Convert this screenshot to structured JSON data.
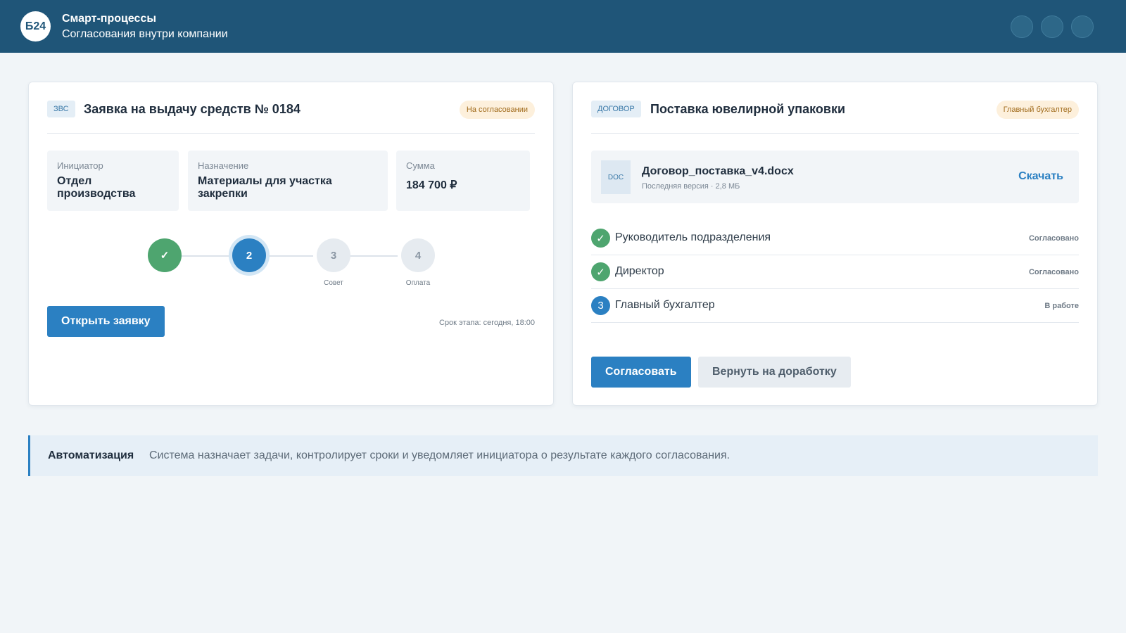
{
  "header": {
    "logo_text": "Б24",
    "title": "Смарт-процессы",
    "subtitle": "Согласования внутри компании"
  },
  "left_card": {
    "tag": "ЗВС",
    "title": "Заявка на выдачу средств № 0184",
    "status_badge": "На согласовании",
    "info": [
      {
        "label": "Инициатор",
        "value": "Отдел производства"
      },
      {
        "label": "Назначение",
        "value": "Материалы для участка закрепки"
      },
      {
        "label": "Сумма",
        "value": "184 700 ₽"
      }
    ],
    "steps": [
      {
        "text": "✓",
        "label": "",
        "state": "done"
      },
      {
        "text": "2",
        "label": "",
        "state": "current"
      },
      {
        "text": "3",
        "label": "Совет",
        "state": "todo"
      },
      {
        "text": "4",
        "label": "Оплата",
        "state": "todo"
      }
    ],
    "open_button": "Открыть заявку",
    "deadline": "Срок этапа: сегодня, 18:00"
  },
  "right_card": {
    "tag": "ДОГОВОР",
    "title": "Поставка ювелирной упаковки",
    "role_badge": "Главный бухгалтер",
    "file": {
      "type": "DOC",
      "name": "Договор_поставка_v4.docx",
      "meta": "Последняя версия · 2,8 МБ",
      "download_label": "Скачать"
    },
    "approvers": [
      {
        "icon": "✓",
        "kind": "ok",
        "name": "Руководитель подразделения",
        "status": "Согласовано"
      },
      {
        "icon": "✓",
        "kind": "ok",
        "name": "Директор",
        "status": "Согласовано"
      },
      {
        "icon": "3",
        "kind": "num",
        "name": "Главный бухгалтер",
        "status": "В работе"
      }
    ],
    "approve_button": "Согласовать",
    "return_button": "Вернуть на доработку"
  },
  "automation": {
    "title": "Автоматизация",
    "text": "Система назначает задачи, контролирует сроки и уведомляет инициатора о результате каждого согласования."
  },
  "colors": {
    "header_bg": "#1f5578",
    "primary": "#2b80c2",
    "success": "#4ea56f",
    "badge_bg": "#fdf0dc"
  }
}
